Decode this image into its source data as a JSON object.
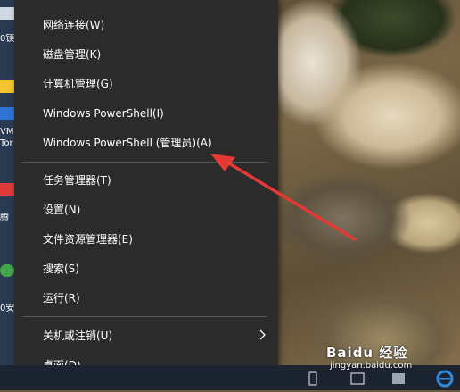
{
  "menu": {
    "items": [
      {
        "label": "网络连接(W)"
      },
      {
        "label": "磁盘管理(K)"
      },
      {
        "label": "计算机管理(G)"
      },
      {
        "label": "Windows PowerShell(I)"
      },
      {
        "label": "Windows PowerShell (管理员)(A)"
      },
      {
        "label": "任务管理器(T)"
      },
      {
        "label": "设置(N)"
      },
      {
        "label": "文件资源管理器(E)"
      },
      {
        "label": "搜索(S)"
      },
      {
        "label": "运行(R)"
      },
      {
        "label": "关机或注销(U)",
        "has_submenu": true
      },
      {
        "label": "桌面(D)"
      }
    ]
  },
  "desktop": {
    "left_labels": [
      "0镁",
      "VM",
      "Tor",
      "腾",
      "0安"
    ]
  },
  "watermark": {
    "logo": "Baidu 经验",
    "url": "jingyan.baidu.com"
  },
  "colors": {
    "menu_bg": "#2b2b2b",
    "menu_text": "#ffffff",
    "separator": "#575757",
    "annotation": "#e53935",
    "taskbar": "#1c2331"
  },
  "icons": {
    "submenu_arrow": "chevron-right-icon",
    "annotation": "red-arrow-annotation"
  }
}
